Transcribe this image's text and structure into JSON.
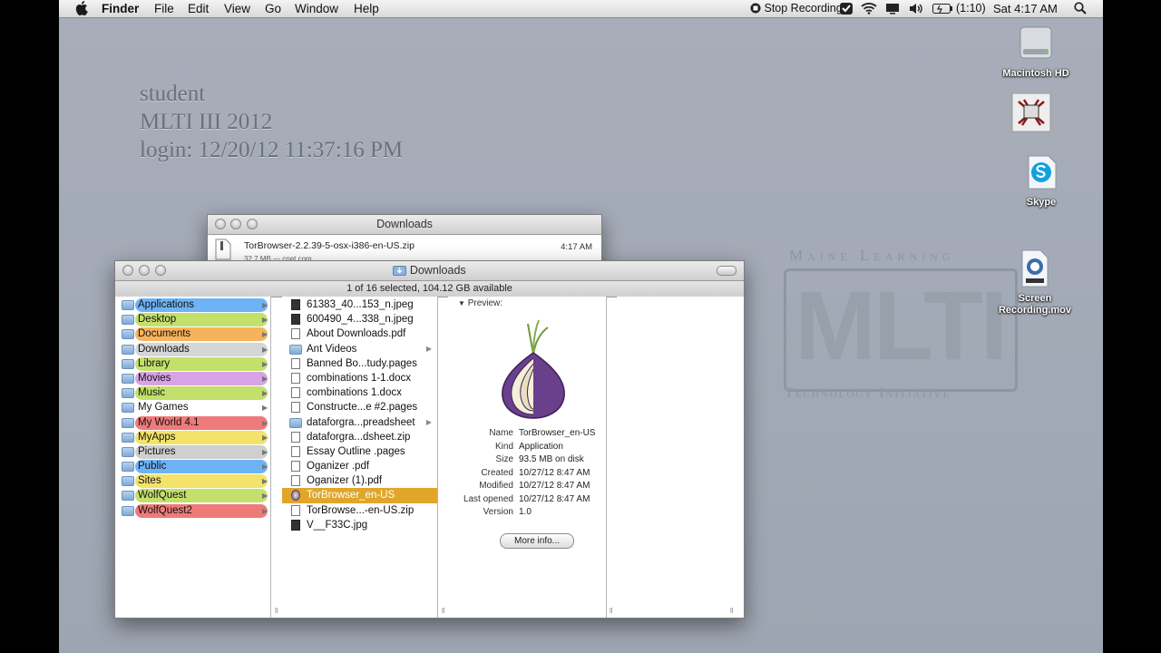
{
  "menubar": {
    "app": "Finder",
    "menus": [
      "File",
      "Edit",
      "View",
      "Go",
      "Window",
      "Help"
    ],
    "stop_recording": "Stop Recording",
    "battery": "(1:10)",
    "clock": "Sat 4:17 AM"
  },
  "login_info": {
    "line1": "student",
    "line2": "MLTI III 2012",
    "line3": "login: 12/20/12 11:37:16 PM"
  },
  "wallpaper": {
    "top": "Maine Learning",
    "logo": "MLTI",
    "bottom": "Technology Initiative"
  },
  "desktop_icons": [
    {
      "label": "Macintosh HD",
      "icon": "hard-drive-icon"
    },
    {
      "label": "",
      "icon": "image-file-icon"
    },
    {
      "label": "Skype",
      "icon": "skype-icon"
    },
    {
      "label": "Screen Recording.mov",
      "icon": "movie-file-icon"
    }
  ],
  "downloads_window": {
    "title": "Downloads",
    "item_name": "TorBrowser-2.2.39-5-osx-i386-en-US.zip",
    "item_time": "4:17 AM",
    "item_meta": "32.7 MB — cnet.com"
  },
  "finder_window": {
    "title": "Downloads",
    "status": "1 of 16 selected, 104.12 GB available",
    "sidebar": [
      {
        "label": "Applications",
        "color": "#6eb3f5"
      },
      {
        "label": "Desktop",
        "color": "#c3e06b"
      },
      {
        "label": "Documents",
        "color": "#f7b35c"
      },
      {
        "label": "Downloads",
        "color": "#d6d6d6"
      },
      {
        "label": "Library",
        "color": "#c3e06b"
      },
      {
        "label": "Movies",
        "color": "#d7a3e6"
      },
      {
        "label": "Music",
        "color": "#c3e06b"
      },
      {
        "label": "My Games",
        "color": ""
      },
      {
        "label": "My World 4.1",
        "color": "#ef7a7a"
      },
      {
        "label": "MyApps",
        "color": "#f3e36a"
      },
      {
        "label": "Pictures",
        "color": "#cfcfcf"
      },
      {
        "label": "Public",
        "color": "#6eb3f5"
      },
      {
        "label": "Sites",
        "color": "#f3e36a"
      },
      {
        "label": "WolfQuest",
        "color": "#c3e06b"
      },
      {
        "label": "WolfQuest2",
        "color": "#ef7a7a"
      }
    ],
    "files": [
      {
        "name": "61383_40...153_n.jpeg",
        "kind": "img",
        "folder": false
      },
      {
        "name": "600490_4...338_n.jpeg",
        "kind": "img",
        "folder": false
      },
      {
        "name": "About Downloads.pdf",
        "kind": "doc",
        "folder": false
      },
      {
        "name": "Ant Videos",
        "kind": "folder",
        "folder": true
      },
      {
        "name": "Banned Bo...tudy.pages",
        "kind": "doc",
        "folder": false
      },
      {
        "name": "combinations 1-1.docx",
        "kind": "doc",
        "folder": false
      },
      {
        "name": "combinations 1.docx",
        "kind": "doc",
        "folder": false
      },
      {
        "name": "Constructe...e #2.pages",
        "kind": "doc",
        "folder": false
      },
      {
        "name": "dataforgra...preadsheet",
        "kind": "folder",
        "folder": true
      },
      {
        "name": "dataforgra...dsheet.zip",
        "kind": "doc",
        "folder": false
      },
      {
        "name": "Essay Outline .pages",
        "kind": "doc",
        "folder": false
      },
      {
        "name": "Oganizer .pdf",
        "kind": "doc",
        "folder": false
      },
      {
        "name": "Oganizer (1).pdf",
        "kind": "doc",
        "folder": false
      },
      {
        "name": "TorBrowser_en-US",
        "kind": "app",
        "folder": false
      },
      {
        "name": "TorBrowse...-en-US.zip",
        "kind": "doc",
        "folder": false
      },
      {
        "name": "V__F33C.jpg",
        "kind": "img",
        "folder": false
      }
    ],
    "selected_index": 13,
    "preview": {
      "header": "Preview:",
      "rows": [
        {
          "k": "Name",
          "v": "TorBrowser_en-US"
        },
        {
          "k": "Kind",
          "v": "Application"
        },
        {
          "k": "Size",
          "v": "93.5 MB on disk"
        },
        {
          "k": "Created",
          "v": "10/27/12 8:47 AM"
        },
        {
          "k": "Modified",
          "v": "10/27/12 8:47 AM"
        },
        {
          "k": "Last opened",
          "v": "10/27/12 8:47 AM"
        },
        {
          "k": "Version",
          "v": "1.0"
        }
      ],
      "more_info": "More info..."
    }
  }
}
